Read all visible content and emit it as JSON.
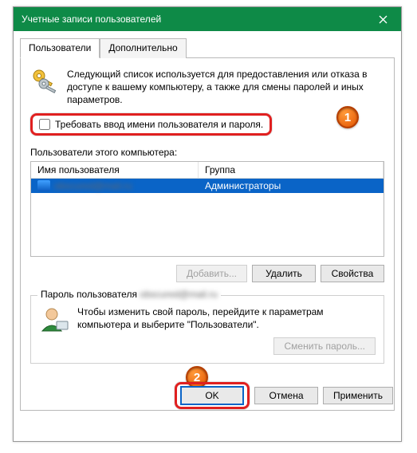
{
  "window": {
    "title": "Учетные записи пользователей"
  },
  "tabs": {
    "users": "Пользователи",
    "advanced": "Дополнительно"
  },
  "description": "Следующий список используется для предоставления или отказа в доступе к вашему компьютеру, а также для смены паролей и иных параметров.",
  "checkbox": {
    "label": "Требовать ввод имени пользователя и пароля."
  },
  "users_label": "Пользователи этого компьютера:",
  "table": {
    "col_user": "Имя пользователя",
    "col_group": "Группа",
    "rows": [
      {
        "user": "obscured@mail.ru",
        "group": "Администраторы"
      }
    ]
  },
  "buttons": {
    "add": "Добавить...",
    "remove": "Удалить",
    "properties": "Свойства",
    "change_password": "Сменить пароль...",
    "ok": "OK",
    "cancel": "Отмена",
    "apply": "Применить"
  },
  "password_group": {
    "legend_prefix": "Пароль пользователя ",
    "legend_blur": "obscured@mail.ru",
    "text": "Чтобы изменить свой пароль, перейдите к параметрам компьютера и выберите \"Пользователи\"."
  },
  "annotations": {
    "b1": "1",
    "b2": "2"
  }
}
